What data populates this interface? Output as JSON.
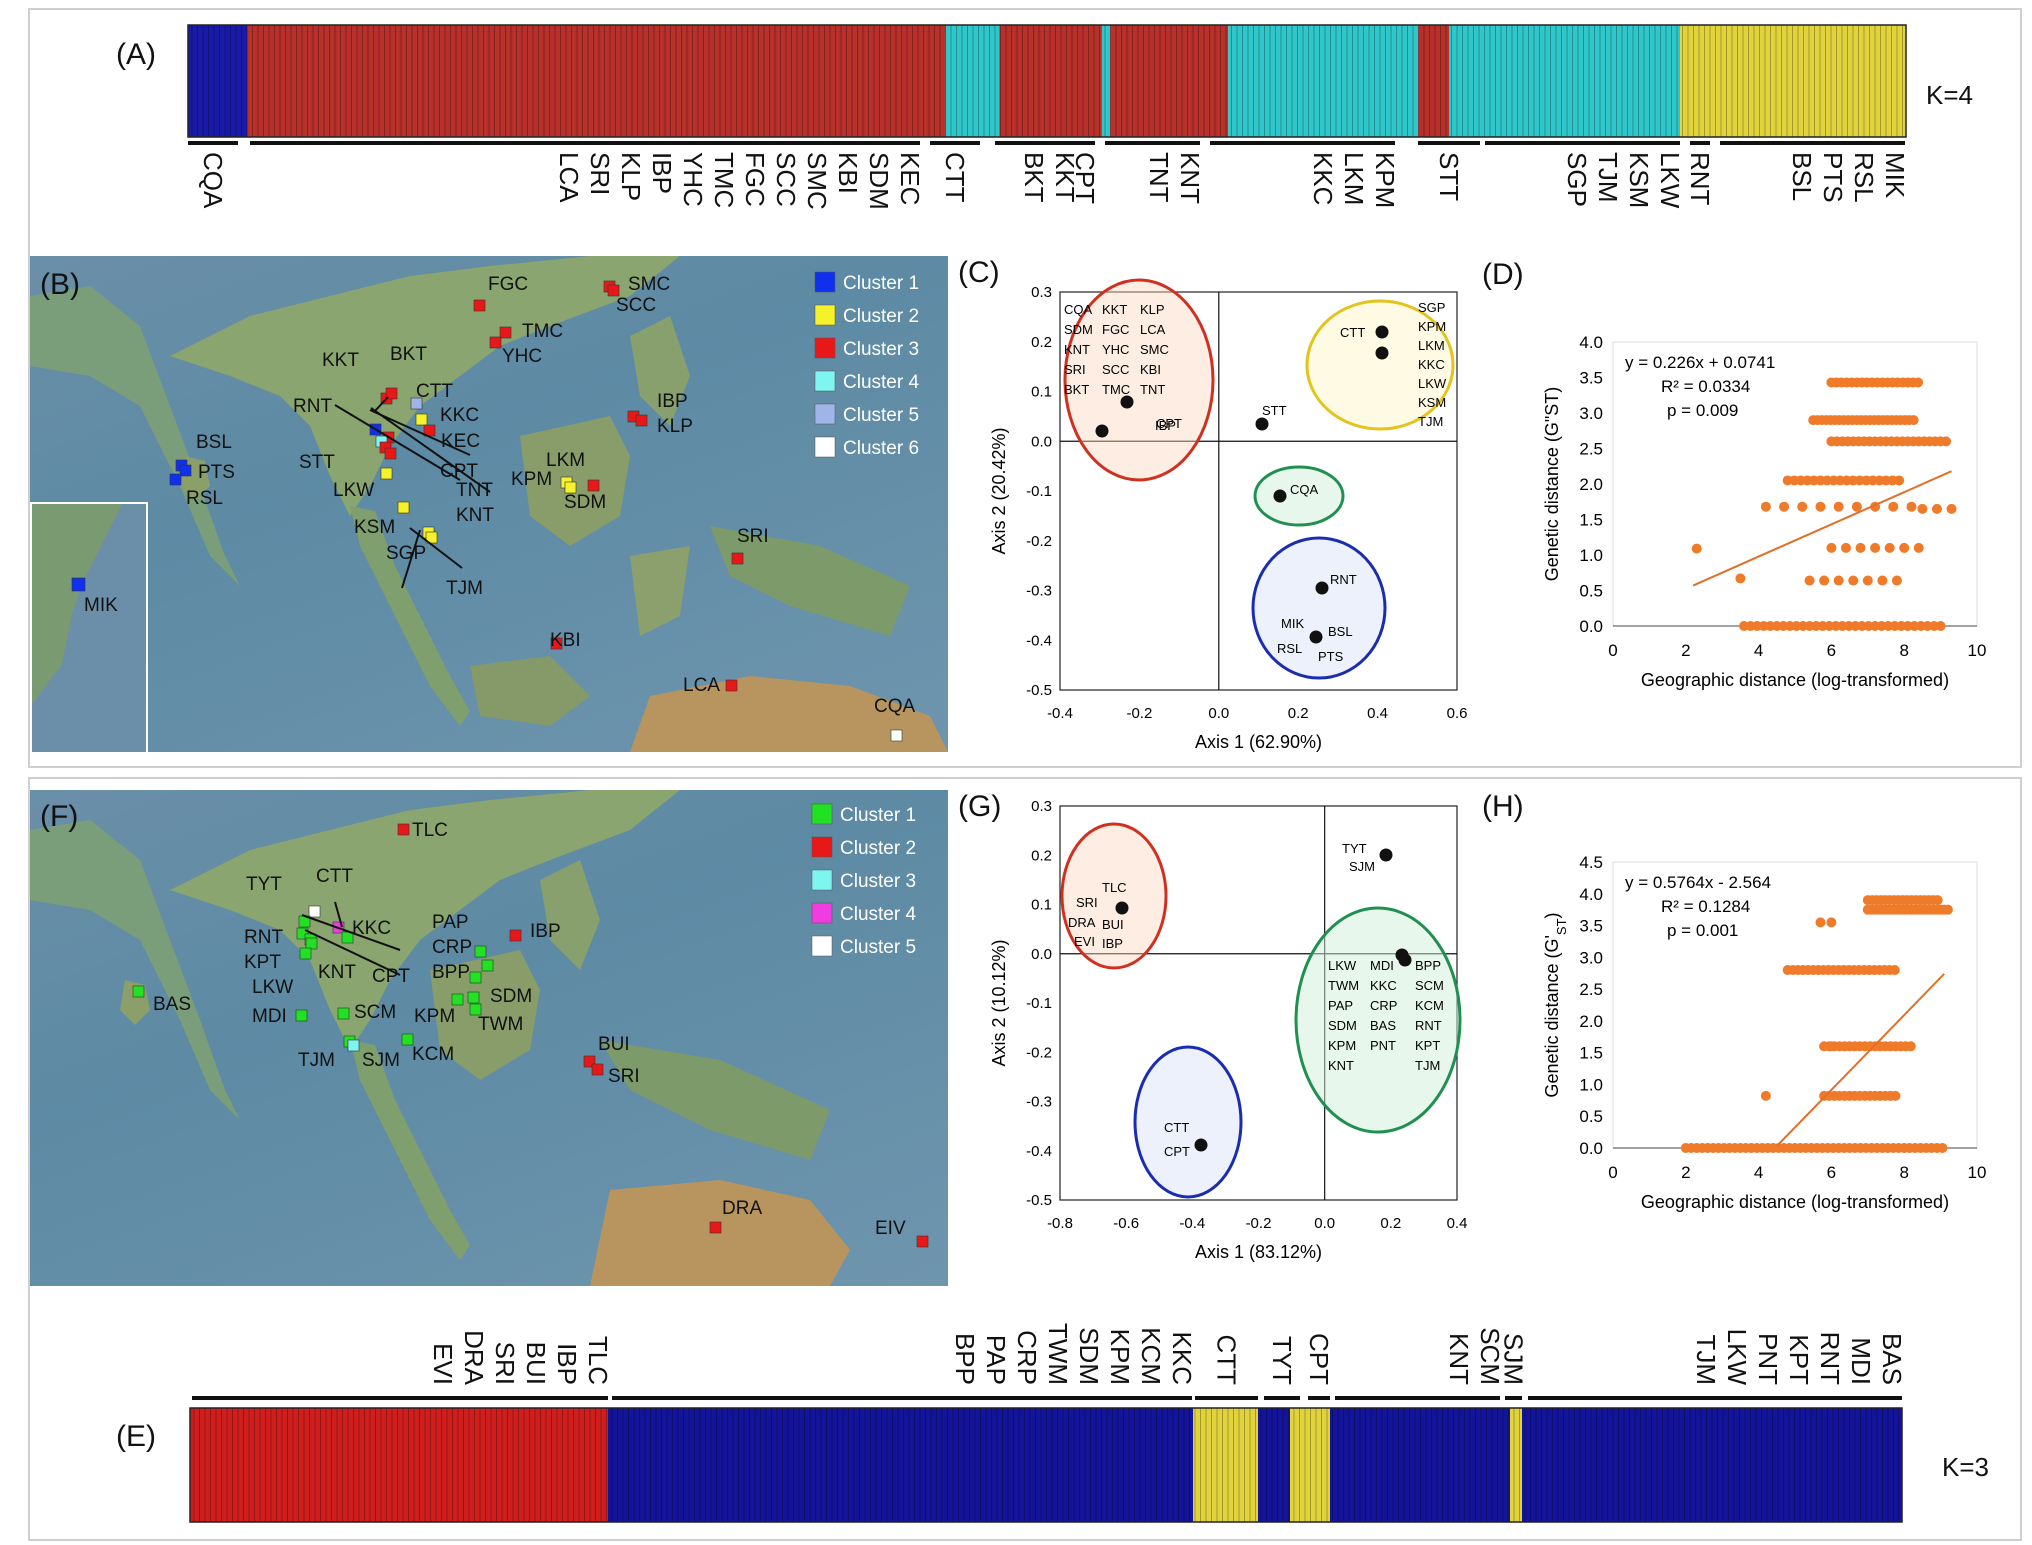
{
  "top": {
    "a": {
      "label": "(A)",
      "k_label": "K=4",
      "blocks": [
        {
          "color": "#1a1aa8",
          "w": 58
        },
        {
          "color": "#b8302a",
          "w": 680
        },
        {
          "color": "#2fc7c9",
          "w": 52
        },
        {
          "color": "#b8302a",
          "w": 100
        },
        {
          "color": "#2fc7c9",
          "w": 8
        },
        {
          "color": "#b8302a",
          "w": 115
        },
        {
          "color": "#2fc7c9",
          "w": 185
        },
        {
          "color": "#b8302a",
          "w": 30
        },
        {
          "color": "#2fc7c9",
          "w": 225
        },
        {
          "color": "#e1d33c",
          "w": 220
        }
      ],
      "groups": [
        {
          "x1": 188,
          "x2": 238,
          "labels": [
            "CQA"
          ]
        },
        {
          "x1": 250,
          "x2": 920,
          "labels": [
            "LCA",
            "SRI",
            "KLP",
            "IBP",
            "YHC",
            "TMC",
            "FGC",
            "SCC",
            "SMC",
            "KBI",
            "SDM",
            "KEC"
          ]
        },
        {
          "x1": 930,
          "x2": 980,
          "labels": [
            "CTT"
          ]
        },
        {
          "x1": 995,
          "x2": 1075,
          "labels": [
            "BKT",
            "KKT"
          ]
        },
        {
          "x1": 1075,
          "x2": 1095,
          "labels": [
            "CPT"
          ]
        },
        {
          "x1": 1105,
          "x2": 1200,
          "labels": [
            "TNT",
            "KNT"
          ]
        },
        {
          "x1": 1210,
          "x2": 1395,
          "labels": [
            "KKC",
            "LKM",
            "KPM"
          ]
        },
        {
          "x1": 1418,
          "x2": 1480,
          "labels": [
            "STT"
          ]
        },
        {
          "x1": 1485,
          "x2": 1680,
          "labels": [
            "SGP",
            "TJM",
            "KSM",
            "LKW"
          ]
        },
        {
          "x1": 1690,
          "x2": 1710,
          "labels": [
            "RNT"
          ]
        },
        {
          "x1": 1720,
          "x2": 1905,
          "labels": [
            "BSL",
            "PTS",
            "RSL",
            "MIK"
          ]
        }
      ]
    },
    "b": {
      "label": "(B)",
      "legend": [
        {
          "label": "Cluster 1",
          "color": "#1030f0"
        },
        {
          "label": "Cluster 2",
          "color": "#f6f22a"
        },
        {
          "label": "Cluster 3",
          "color": "#e81818"
        },
        {
          "label": "Cluster 4",
          "color": "#7ff5f0"
        },
        {
          "label": "Cluster 5",
          "color": "#9fb4e8"
        },
        {
          "label": "Cluster 6",
          "color": "#ffffff"
        }
      ],
      "sites": [
        {
          "name": "FGC",
          "color": "#e81818"
        },
        {
          "name": "SMC",
          "color": "#e81818"
        },
        {
          "name": "SCC",
          "color": "#e81818"
        },
        {
          "name": "TMC",
          "color": "#e81818"
        },
        {
          "name": "YHC",
          "color": "#e81818"
        },
        {
          "name": "KKT",
          "color": "#e81818"
        },
        {
          "name": "BKT",
          "color": "#e81818"
        },
        {
          "name": "CTT",
          "color": "#9fb4e8"
        },
        {
          "name": "KKC",
          "color": "#f6f22a"
        },
        {
          "name": "KEC",
          "color": "#e81818"
        },
        {
          "name": "RNT",
          "color": "#1030f0"
        },
        {
          "name": "CPT",
          "color": "#e81818"
        },
        {
          "name": "STT",
          "color": "#7ff5f0"
        },
        {
          "name": "TNT",
          "color": "#e81818"
        },
        {
          "name": "KNT",
          "color": "#e81818"
        },
        {
          "name": "BSL",
          "color": "#1030f0"
        },
        {
          "name": "PTS",
          "color": "#1030f0"
        },
        {
          "name": "RSL",
          "color": "#1030f0"
        },
        {
          "name": "LKW",
          "color": "#f6f22a"
        },
        {
          "name": "KSM",
          "color": "#f6f22a"
        },
        {
          "name": "SGP",
          "color": "#f6f22a"
        },
        {
          "name": "TJM",
          "color": "#f6f22a"
        },
        {
          "name": "LKM",
          "color": "#f6f22a"
        },
        {
          "name": "KPM",
          "color": "#f6f22a"
        },
        {
          "name": "SDM",
          "color": "#e81818"
        },
        {
          "name": "IBP",
          "color": "#e81818"
        },
        {
          "name": "KLP",
          "color": "#e81818"
        },
        {
          "name": "SRI",
          "color": "#e81818"
        },
        {
          "name": "KBI",
          "color": "#e81818"
        },
        {
          "name": "LCA",
          "color": "#e81818"
        },
        {
          "name": "CQA",
          "color": "#ffffff"
        }
      ],
      "inset_site": {
        "name": "MIK",
        "color": "#1030f0"
      }
    },
    "c": {
      "label": "(C)",
      "xlabel": "Axis 1 (62.90%)",
      "ylabel": "Axis 2 (20.42%)",
      "xticks": [
        "-0.4",
        "-0.2",
        "0.0",
        "0.2",
        "0.4",
        "0.6"
      ],
      "yticks": [
        "0.3",
        "0.2",
        "0.1",
        "0.0",
        "-0.1",
        "-0.2",
        "-0.3",
        "-0.4",
        "-0.5"
      ],
      "red_group": [
        "CQA",
        "KKT",
        "KLP",
        "SDM",
        "FGC",
        "LCA",
        "KNT",
        "YHC",
        "SMC",
        "SRI",
        "SCC",
        "KBI",
        "BKT",
        "TMC",
        "TNT",
        "IBP",
        "CPT"
      ],
      "yellow_group": [
        "SGP",
        "CTT",
        "KPM",
        "LKM",
        "KKC",
        "LKW",
        "KSM",
        "TJM"
      ],
      "green_group": [
        "CQA"
      ],
      "blue_group": [
        "RNT",
        "MIK",
        "BSL",
        "RSL",
        "PTS"
      ],
      "stt": "STT"
    },
    "d": {
      "label": "(D)",
      "equation": "y = 0.226x + 0.0741",
      "r2": "R² = 0.0334",
      "p": "p = 0.009",
      "xlabel": "Geographic distance (log-transformed)",
      "ylabel": "Genetic distance (G\"ST)",
      "xticks": [
        "0",
        "2",
        "4",
        "6",
        "8",
        "10"
      ],
      "yticks": [
        "4.0",
        "3.5",
        "3.0",
        "2.5",
        "2.0",
        "1.5",
        "1.0",
        "0.5",
        "0.0"
      ]
    }
  },
  "bottom": {
    "f": {
      "label": "(F)",
      "legend": [
        {
          "label": "Cluster 1",
          "color": "#22e022"
        },
        {
          "label": "Cluster 2",
          "color": "#e81818"
        },
        {
          "label": "Cluster 3",
          "color": "#7ff5f0"
        },
        {
          "label": "Cluster 4",
          "color": "#f03ce0"
        },
        {
          "label": "Cluster 5",
          "color": "#ffffff"
        }
      ],
      "sites": [
        {
          "name": "TLC",
          "color": "#e81818"
        },
        {
          "name": "TYT",
          "color": "#ffffff"
        },
        {
          "name": "CTT",
          "color": "#f03ce0"
        },
        {
          "name": "KKC",
          "color": "#22e022"
        },
        {
          "name": "RNT",
          "color": "#22e022"
        },
        {
          "name": "KPT",
          "color": "#22e022"
        },
        {
          "name": "KNT",
          "color": "#22e022"
        },
        {
          "name": "CPT",
          "color": "#22e022"
        },
        {
          "name": "LKW",
          "color": "#22e022"
        },
        {
          "name": "BAS",
          "color": "#22e022"
        },
        {
          "name": "MDI",
          "color": "#22e022"
        },
        {
          "name": "SCM",
          "color": "#22e022"
        },
        {
          "name": "TJM",
          "color": "#22e022"
        },
        {
          "name": "SJM",
          "color": "#7ff5f0"
        },
        {
          "name": "PAP",
          "color": "#22e022"
        },
        {
          "name": "CRP",
          "color": "#22e022"
        },
        {
          "name": "BPP",
          "color": "#22e022"
        },
        {
          "name": "KPM",
          "color": "#22e022"
        },
        {
          "name": "SDM",
          "color": "#22e022"
        },
        {
          "name": "TWM",
          "color": "#22e022"
        },
        {
          "name": "KCM",
          "color": "#22e022"
        },
        {
          "name": "IBP",
          "color": "#e81818"
        },
        {
          "name": "BUI",
          "color": "#e81818"
        },
        {
          "name": "SRI",
          "color": "#e81818"
        },
        {
          "name": "DRA",
          "color": "#e81818"
        },
        {
          "name": "EIV",
          "color": "#e81818"
        }
      ]
    },
    "g": {
      "label": "(G)",
      "xlabel": "Axis 1 (83.12%)",
      "ylabel": "Axis 2 (10.12%)",
      "xticks": [
        "-0.8",
        "-0.6",
        "-0.4",
        "-0.2",
        "0.0",
        "0.2",
        "0.4"
      ],
      "yticks": [
        "0.3",
        "0.2",
        "0.1",
        "0.0",
        "-0.1",
        "-0.2",
        "-0.3",
        "-0.4",
        "-0.5"
      ],
      "red_group": [
        "TLC",
        "SRI",
        "DRA",
        "BUI",
        "EVI",
        "IBP"
      ],
      "blue_group": [
        "CTT",
        "CPT"
      ],
      "top_group": [
        "TYT",
        "SJM"
      ],
      "green_group": [
        "LKW",
        "MDI",
        "BPP",
        "TWM",
        "KKC",
        "SCM",
        "PAP",
        "CRP",
        "KCM",
        "SDM",
        "BAS",
        "RNT",
        "KPM",
        "PNT",
        "KPT",
        "KNT",
        "TJM"
      ]
    },
    "h": {
      "label": "(H)",
      "equation": "y = 0.5764x - 2.564",
      "r2": "R² = 0.1284",
      "p": "p = 0.001",
      "xlabel": "Geographic distance (log-transformed)",
      "ylabel_main": "Genetic distance (G'",
      "ylabel_sub": "ST",
      "ylabel_end": ")",
      "xticks": [
        "0",
        "2",
        "4",
        "6",
        "8",
        "10"
      ],
      "yticks": [
        "4.5",
        "4.0",
        "3.5",
        "3.0",
        "2.5",
        "2.0",
        "1.5",
        "1.0",
        "0.5",
        "0.0"
      ]
    },
    "e": {
      "label": "(E)",
      "k_label": "K=3",
      "blocks": [
        {
          "color": "#d01e1e",
          "w": 418
        },
        {
          "color": "#14149a",
          "w": 585
        },
        {
          "color": "#e1d33c",
          "w": 65
        },
        {
          "color": "#14149a",
          "w": 32
        },
        {
          "color": "#e1d33c",
          "w": 40
        },
        {
          "color": "#14149a",
          "w": 180
        },
        {
          "color": "#e1d33c",
          "w": 12
        },
        {
          "color": "#14149a",
          "w": 380
        }
      ],
      "groups": [
        {
          "x1": 192,
          "x2": 608,
          "labels": [
            "EVI",
            "DRA",
            "SRI",
            "BUI",
            "IBP",
            "TLC"
          ]
        },
        {
          "x1": 612,
          "x2": 1192,
          "labels": [
            "BPP",
            "PAP",
            "CRP",
            "TWM",
            "SDM",
            "KPM",
            "KCM",
            "KKC"
          ]
        },
        {
          "x1": 1195,
          "x2": 1258,
          "labels": [
            "CTT"
          ]
        },
        {
          "x1": 1264,
          "x2": 1300,
          "labels": [
            "TYT"
          ]
        },
        {
          "x1": 1308,
          "x2": 1330,
          "labels": [
            "CPT"
          ]
        },
        {
          "x1": 1335,
          "x2": 1500,
          "labels": [
            "KNT",
            "SCM"
          ]
        },
        {
          "x1": 1505,
          "x2": 1522,
          "labels": [
            "SJM"
          ]
        },
        {
          "x1": 1528,
          "x2": 1902,
          "labels": [
            "TJM",
            "LKW",
            "PNT",
            "KPT",
            "RNT",
            "MDI",
            "BAS"
          ]
        }
      ]
    }
  }
}
